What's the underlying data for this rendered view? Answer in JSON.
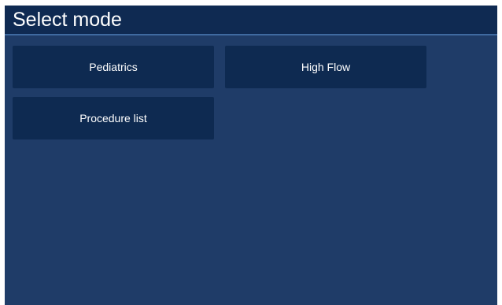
{
  "header": {
    "title": "Select mode"
  },
  "modes": [
    {
      "label": "Pediatrics"
    },
    {
      "label": "High Flow"
    },
    {
      "label": "Procedure list"
    }
  ],
  "colors": {
    "background": "#1f3c68",
    "header": "#0f2a52",
    "button": "#0e2a51",
    "text": "#ffffff"
  }
}
